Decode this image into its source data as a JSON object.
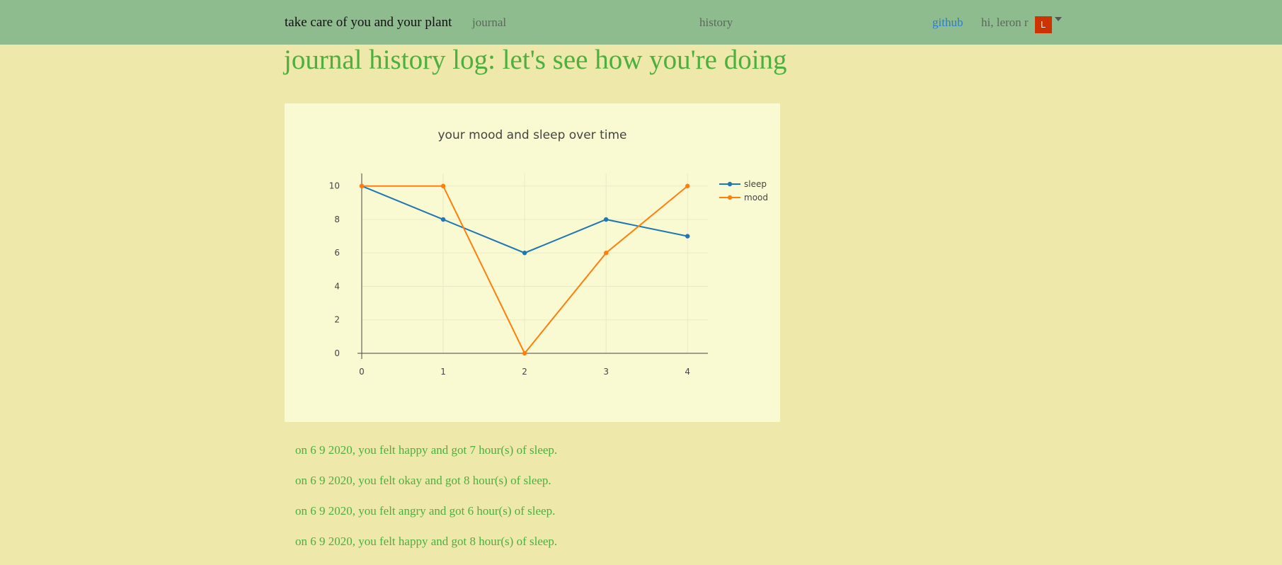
{
  "nav": {
    "brand": "take care of you and your plant",
    "journal": "journal",
    "history": "history",
    "github": "github",
    "greeting": "hi, leron r",
    "avatar_letter": "L"
  },
  "page": {
    "title": "journal history log: let's see how you're doing"
  },
  "chart_data": {
    "type": "line",
    "title": "your mood and sleep over time",
    "xlabel": "",
    "ylabel": "",
    "x": [
      0,
      1,
      2,
      3,
      4
    ],
    "series": [
      {
        "name": "sleep",
        "values": [
          10,
          8,
          6,
          8,
          7
        ],
        "color": "#1f77b4"
      },
      {
        "name": "mood",
        "values": [
          10,
          10,
          0,
          6,
          10
        ],
        "color": "#ff7f0e"
      }
    ],
    "xlim": [
      0,
      4.25
    ],
    "ylim": [
      0,
      10.75
    ],
    "xticks": [
      "0",
      "1",
      "2",
      "3",
      "4"
    ],
    "yticks": [
      "0",
      "2",
      "4",
      "6",
      "8",
      "10"
    ],
    "grid": true,
    "legend": "top-right"
  },
  "entries": [
    "on 6 9 2020, you felt happy and got 7 hour(s) of sleep.",
    "on 6 9 2020, you felt okay and got 8 hour(s) of sleep.",
    "on 6 9 2020, you felt angry and got 6 hour(s) of sleep.",
    "on 6 9 2020, you felt happy and got 8 hour(s) of sleep."
  ],
  "colors": {
    "page_bg": "#eee8aa",
    "navbar_bg": "#8fbc8f",
    "accent_green": "#4caf3f",
    "link_blue": "#2b7bd6",
    "avatar_bg": "#cc3300",
    "chart_bg": "#fafad2"
  }
}
